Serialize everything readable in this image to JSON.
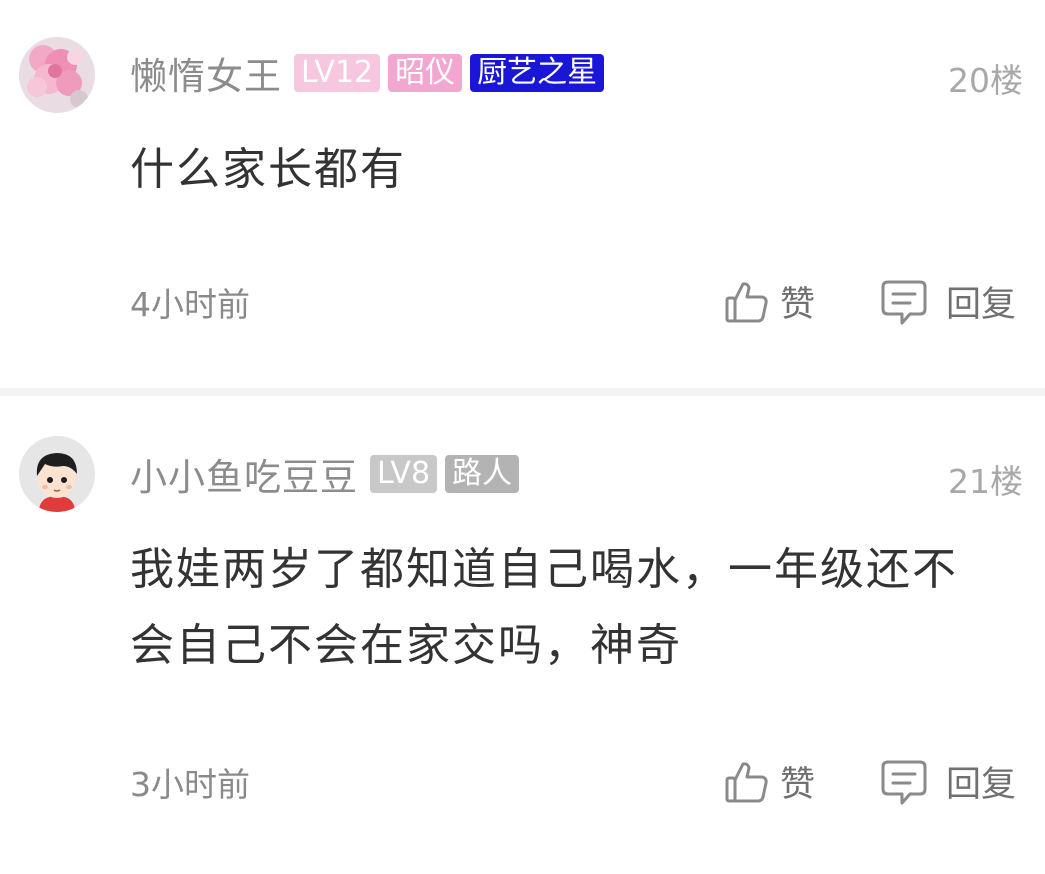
{
  "comments": [
    {
      "username": "懒惰女王",
      "badges": [
        {
          "text": "LV12",
          "color": "#f6c7de"
        },
        {
          "text": "昭仪",
          "color": "#f1a7cf"
        },
        {
          "text": "厨艺之星",
          "color": "#1a16d8"
        }
      ],
      "floor": "20楼",
      "content": "什么家长都有",
      "time": "4小时前",
      "like_label": "赞",
      "reply_label": "回复"
    },
    {
      "username": "小小鱼吃豆豆",
      "badges": [
        {
          "text": "LV8",
          "color": "#c8c8c8"
        },
        {
          "text": "路人",
          "color": "#b3b3b3"
        }
      ],
      "floor": "21楼",
      "content": "我娃两岁了都知道自己喝水，一年级还不会自己不会在家交吗，神奇",
      "time": "3小时前",
      "like_label": "赞",
      "reply_label": "回复"
    }
  ],
  "icons": {
    "avatar_1": "pink-flower-avatar-icon",
    "avatar_2": "cartoon-kid-avatar-icon",
    "like": "thumbs-up-icon",
    "reply": "comment-bubble-icon"
  }
}
